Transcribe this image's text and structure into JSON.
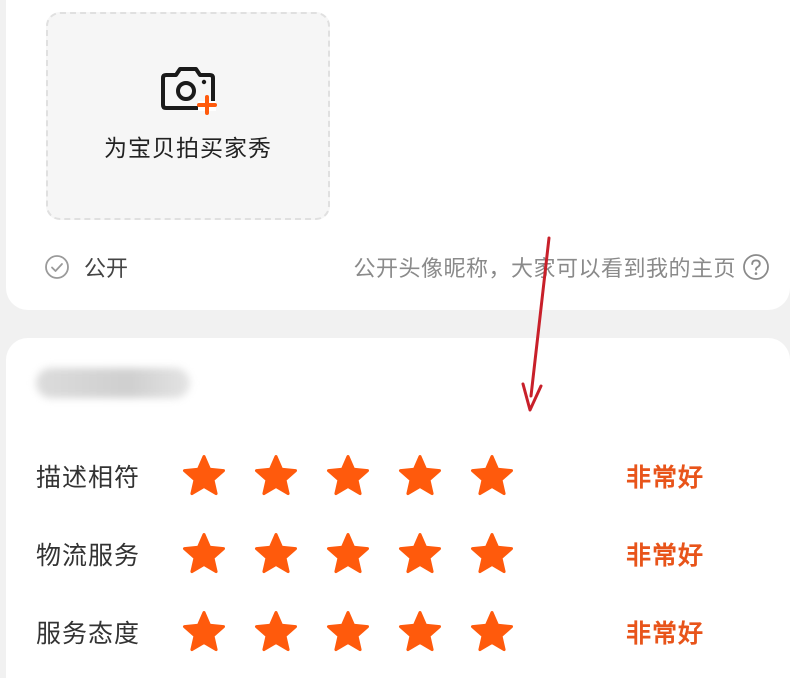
{
  "photo": {
    "upload_label": "为宝贝拍买家秀",
    "camera_icon": "camera-plus-icon"
  },
  "visibility": {
    "label": "公开",
    "hint": "公开头像昵称，大家可以看到我的主页",
    "checked": false
  },
  "ratings": [
    {
      "label": "描述相符",
      "stars": 5,
      "max": 5,
      "text": "非常好"
    },
    {
      "label": "物流服务",
      "stars": 5,
      "max": 5,
      "text": "非常好"
    },
    {
      "label": "服务态度",
      "stars": 5,
      "max": 5,
      "text": "非常好"
    }
  ],
  "colors": {
    "accent": "#ff5a0c",
    "rating_text": "#e8541a",
    "annotation_arrow": "#c8202a"
  }
}
